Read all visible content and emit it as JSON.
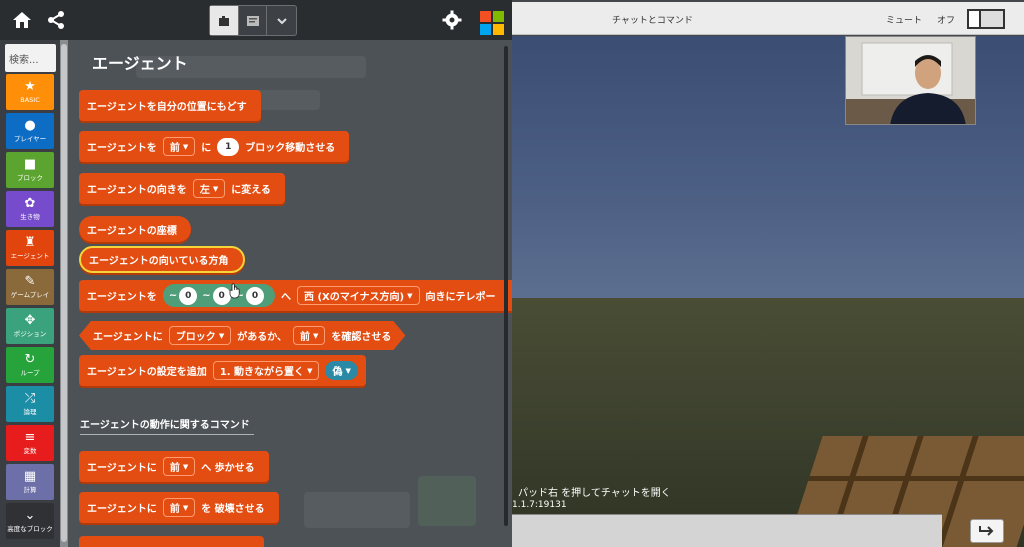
{
  "header": {
    "home_icon": "home-icon",
    "share_icon": "share-icon",
    "settings_icon": "gear-icon"
  },
  "toolbox": {
    "search_placeholder": "検索...",
    "categories": [
      {
        "label": "BASIC",
        "color": "#ff8f08",
        "icon": "star-icon"
      },
      {
        "label": "プレイヤー",
        "color": "#0d6dc4",
        "icon": "person-icon"
      },
      {
        "label": "ブロック",
        "color": "#5ba42f",
        "icon": "cube-icon"
      },
      {
        "label": "生き物",
        "color": "#764bcc",
        "icon": "paw-icon"
      },
      {
        "label": "エージェント",
        "color": "#e2440d",
        "icon": "agent-icon"
      },
      {
        "label": "ゲームプレイ",
        "color": "#8a6a3a",
        "icon": "wrench-icon"
      },
      {
        "label": "ポジション",
        "color": "#3aa37d",
        "icon": "position-icon"
      },
      {
        "label": "ループ",
        "color": "#27a33b",
        "icon": "loop-icon"
      },
      {
        "label": "論理",
        "color": "#1b8ea6",
        "icon": "shuffle-icon"
      },
      {
        "label": "変数",
        "color": "#e71d1d",
        "icon": "list-icon"
      },
      {
        "label": "計算",
        "color": "#6d6fa8",
        "icon": "calculator-icon"
      },
      {
        "label": "高度なブロック",
        "color": "#2f3135",
        "icon": "chevron-down-icon"
      }
    ]
  },
  "flyout": {
    "title": "エージェント",
    "blocks": {
      "b1": "エージェントを自分の位置にもどす",
      "b2_a": "エージェントを",
      "b2_drop": "前",
      "b2_b": "に",
      "b2_num": "1",
      "b2_c": "ブロック移動させる",
      "b3_a": "エージェントの向きを",
      "b3_drop": "左",
      "b3_b": "に変える",
      "b4": "エージェントの座標",
      "b5": "エージェントの向いている方角",
      "b6_a": "エージェントを",
      "b6_x": "0",
      "b6_y": "0",
      "b6_z": "0",
      "b6_b": "へ",
      "b6_drop": "西 (Xのマイナス方向)",
      "b6_c": "向きにテレポー",
      "b7_a": "エージェントに",
      "b7_drop1": "ブロック",
      "b7_b": "があるか、",
      "b7_drop2": "前",
      "b7_c": "を確認させる",
      "b8_a": "エージェントの設定を追加",
      "b8_drop": "1. 動きながら置く",
      "b8_bool": "偽",
      "section": "エージェントの動作に関するコマンド",
      "b9_a": "エージェントに",
      "b9_drop": "前",
      "b9_b": "へ 歩かせる",
      "b10_a": "エージェントに",
      "b10_drop": "前",
      "b10_b": "を 破壊させる"
    }
  },
  "minecraft": {
    "title": "チャットとコマンド",
    "mute_label": "ミュート",
    "off_label": "オフ",
    "chat_hint": "パッド右 を押してチャットを開く",
    "version": "1.1.7:19131"
  }
}
